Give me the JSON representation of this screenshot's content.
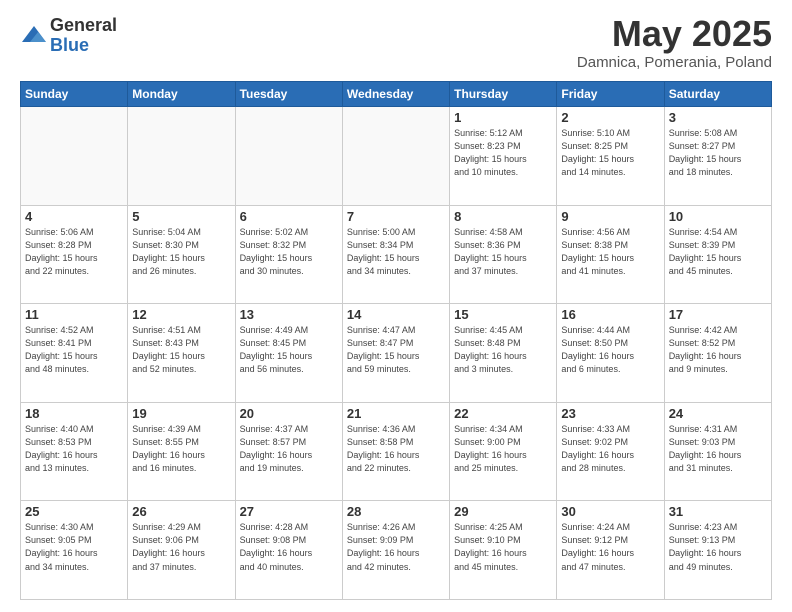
{
  "logo": {
    "general": "General",
    "blue": "Blue"
  },
  "header": {
    "month": "May 2025",
    "location": "Damnica, Pomerania, Poland"
  },
  "weekdays": [
    "Sunday",
    "Monday",
    "Tuesday",
    "Wednesday",
    "Thursday",
    "Friday",
    "Saturday"
  ],
  "weeks": [
    [
      {
        "day": "",
        "info": ""
      },
      {
        "day": "",
        "info": ""
      },
      {
        "day": "",
        "info": ""
      },
      {
        "day": "",
        "info": ""
      },
      {
        "day": "1",
        "info": "Sunrise: 5:12 AM\nSunset: 8:23 PM\nDaylight: 15 hours\nand 10 minutes."
      },
      {
        "day": "2",
        "info": "Sunrise: 5:10 AM\nSunset: 8:25 PM\nDaylight: 15 hours\nand 14 minutes."
      },
      {
        "day": "3",
        "info": "Sunrise: 5:08 AM\nSunset: 8:27 PM\nDaylight: 15 hours\nand 18 minutes."
      }
    ],
    [
      {
        "day": "4",
        "info": "Sunrise: 5:06 AM\nSunset: 8:28 PM\nDaylight: 15 hours\nand 22 minutes."
      },
      {
        "day": "5",
        "info": "Sunrise: 5:04 AM\nSunset: 8:30 PM\nDaylight: 15 hours\nand 26 minutes."
      },
      {
        "day": "6",
        "info": "Sunrise: 5:02 AM\nSunset: 8:32 PM\nDaylight: 15 hours\nand 30 minutes."
      },
      {
        "day": "7",
        "info": "Sunrise: 5:00 AM\nSunset: 8:34 PM\nDaylight: 15 hours\nand 34 minutes."
      },
      {
        "day": "8",
        "info": "Sunrise: 4:58 AM\nSunset: 8:36 PM\nDaylight: 15 hours\nand 37 minutes."
      },
      {
        "day": "9",
        "info": "Sunrise: 4:56 AM\nSunset: 8:38 PM\nDaylight: 15 hours\nand 41 minutes."
      },
      {
        "day": "10",
        "info": "Sunrise: 4:54 AM\nSunset: 8:39 PM\nDaylight: 15 hours\nand 45 minutes."
      }
    ],
    [
      {
        "day": "11",
        "info": "Sunrise: 4:52 AM\nSunset: 8:41 PM\nDaylight: 15 hours\nand 48 minutes."
      },
      {
        "day": "12",
        "info": "Sunrise: 4:51 AM\nSunset: 8:43 PM\nDaylight: 15 hours\nand 52 minutes."
      },
      {
        "day": "13",
        "info": "Sunrise: 4:49 AM\nSunset: 8:45 PM\nDaylight: 15 hours\nand 56 minutes."
      },
      {
        "day": "14",
        "info": "Sunrise: 4:47 AM\nSunset: 8:47 PM\nDaylight: 15 hours\nand 59 minutes."
      },
      {
        "day": "15",
        "info": "Sunrise: 4:45 AM\nSunset: 8:48 PM\nDaylight: 16 hours\nand 3 minutes."
      },
      {
        "day": "16",
        "info": "Sunrise: 4:44 AM\nSunset: 8:50 PM\nDaylight: 16 hours\nand 6 minutes."
      },
      {
        "day": "17",
        "info": "Sunrise: 4:42 AM\nSunset: 8:52 PM\nDaylight: 16 hours\nand 9 minutes."
      }
    ],
    [
      {
        "day": "18",
        "info": "Sunrise: 4:40 AM\nSunset: 8:53 PM\nDaylight: 16 hours\nand 13 minutes."
      },
      {
        "day": "19",
        "info": "Sunrise: 4:39 AM\nSunset: 8:55 PM\nDaylight: 16 hours\nand 16 minutes."
      },
      {
        "day": "20",
        "info": "Sunrise: 4:37 AM\nSunset: 8:57 PM\nDaylight: 16 hours\nand 19 minutes."
      },
      {
        "day": "21",
        "info": "Sunrise: 4:36 AM\nSunset: 8:58 PM\nDaylight: 16 hours\nand 22 minutes."
      },
      {
        "day": "22",
        "info": "Sunrise: 4:34 AM\nSunset: 9:00 PM\nDaylight: 16 hours\nand 25 minutes."
      },
      {
        "day": "23",
        "info": "Sunrise: 4:33 AM\nSunset: 9:02 PM\nDaylight: 16 hours\nand 28 minutes."
      },
      {
        "day": "24",
        "info": "Sunrise: 4:31 AM\nSunset: 9:03 PM\nDaylight: 16 hours\nand 31 minutes."
      }
    ],
    [
      {
        "day": "25",
        "info": "Sunrise: 4:30 AM\nSunset: 9:05 PM\nDaylight: 16 hours\nand 34 minutes."
      },
      {
        "day": "26",
        "info": "Sunrise: 4:29 AM\nSunset: 9:06 PM\nDaylight: 16 hours\nand 37 minutes."
      },
      {
        "day": "27",
        "info": "Sunrise: 4:28 AM\nSunset: 9:08 PM\nDaylight: 16 hours\nand 40 minutes."
      },
      {
        "day": "28",
        "info": "Sunrise: 4:26 AM\nSunset: 9:09 PM\nDaylight: 16 hours\nand 42 minutes."
      },
      {
        "day": "29",
        "info": "Sunrise: 4:25 AM\nSunset: 9:10 PM\nDaylight: 16 hours\nand 45 minutes."
      },
      {
        "day": "30",
        "info": "Sunrise: 4:24 AM\nSunset: 9:12 PM\nDaylight: 16 hours\nand 47 minutes."
      },
      {
        "day": "31",
        "info": "Sunrise: 4:23 AM\nSunset: 9:13 PM\nDaylight: 16 hours\nand 49 minutes."
      }
    ]
  ]
}
